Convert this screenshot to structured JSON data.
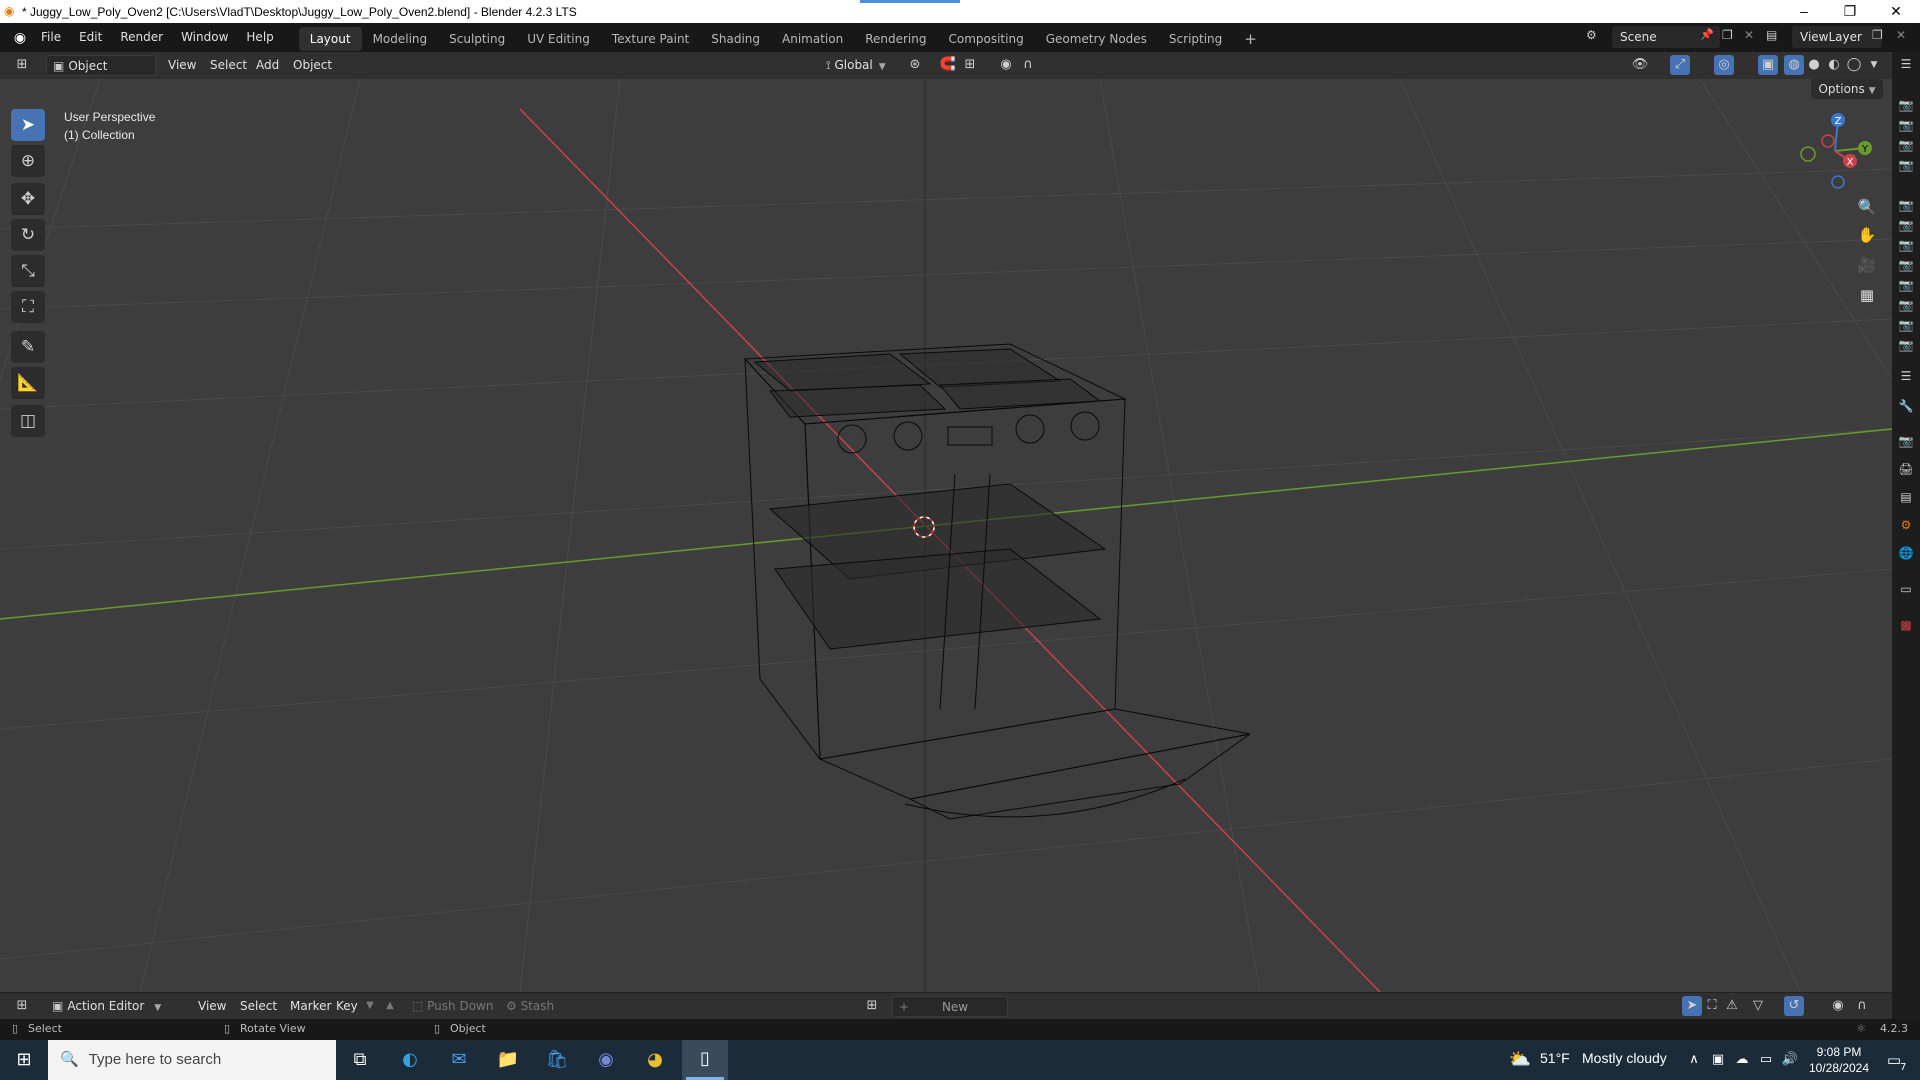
{
  "window": {
    "title": "* Juggy_Low_Poly_Oven2 [C:\\Users\\VladT\\Desktop\\Juggy_Low_Poly_Oven2.blend] - Blender 4.2.3 LTS",
    "minimize": "–",
    "maximize": "❐",
    "close": "✕"
  },
  "menubar": {
    "items": [
      "File",
      "Edit",
      "Render",
      "Window",
      "Help"
    ]
  },
  "workspaces": {
    "tabs": [
      "Layout",
      "Modeling",
      "Sculpting",
      "UV Editing",
      "Texture Paint",
      "Shading",
      "Animation",
      "Rendering",
      "Compositing",
      "Geometry Nodes",
      "Scripting"
    ],
    "active": "Layout",
    "add": "+"
  },
  "scene": {
    "name": "Scene",
    "view_layer": "ViewLayer"
  },
  "viewport_header": {
    "mode": "Object Mode",
    "menus": [
      "View",
      "Select",
      "Add",
      "Object"
    ],
    "orientation": "Global",
    "options": "Options"
  },
  "viewport": {
    "perspective_label": "User Perspective",
    "collection_label": "(1) Collection",
    "gizmo": {
      "x": "X",
      "y": "Y",
      "z": "Z"
    },
    "colors": {
      "background": "#3d3d3d",
      "grid": "#4a4a4a",
      "x_axis": "#c8414b",
      "y_axis": "#6a9a2e",
      "wire": "#0a0a0a"
    }
  },
  "action_editor": {
    "editor": "Action Editor",
    "menus": [
      "View",
      "Select",
      "Marker",
      "Key"
    ],
    "push_down": "Push Down",
    "stash": "Stash",
    "new": "New"
  },
  "statusbar": {
    "select": "Select",
    "rotate": "Rotate View",
    "object": "Object",
    "version": "4.2.3"
  },
  "taskbar": {
    "search_placeholder": "Type here to search",
    "weather_temp": "51°F",
    "weather_desc": "Mostly cloudy",
    "time": "9:08 PM",
    "date": "10/28/2024",
    "notification_count": "7"
  }
}
